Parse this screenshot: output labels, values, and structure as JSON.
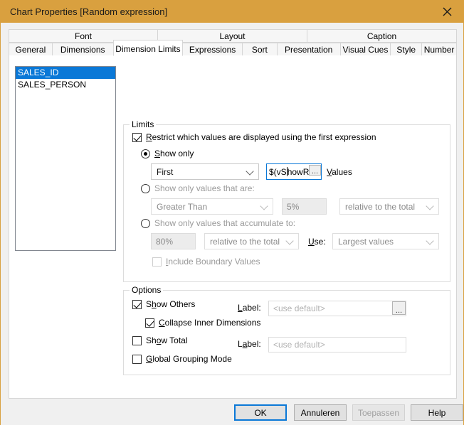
{
  "window": {
    "title": "Chart Properties [Random expression]",
    "close_icon": "close-icon",
    "titlebar_color": "#d9a03f",
    "accent_color": "#0a78d7"
  },
  "tabs": {
    "row1": [
      {
        "label": "Font",
        "active": false
      },
      {
        "label": "Layout",
        "active": false
      },
      {
        "label": "Caption",
        "active": false
      }
    ],
    "row2": [
      {
        "label": "General",
        "active": false
      },
      {
        "label": "Dimensions",
        "active": false
      },
      {
        "label": "Dimension Limits",
        "active": true
      },
      {
        "label": "Expressions",
        "active": false
      },
      {
        "label": "Sort",
        "active": false
      },
      {
        "label": "Presentation",
        "active": false
      },
      {
        "label": "Visual Cues",
        "active": false
      },
      {
        "label": "Style",
        "active": false
      },
      {
        "label": "Number",
        "active": false
      }
    ]
  },
  "dimension_list": {
    "items": [
      {
        "label": "SALES_ID",
        "selected": true
      },
      {
        "label": "SALES_PERSON",
        "selected": false
      }
    ]
  },
  "limits": {
    "group_title": "Limits",
    "restrict": {
      "label_pre": "R",
      "label_post": "estrict which values are displayed using the first expression",
      "checked": true
    },
    "show_only": {
      "label_pre": "S",
      "label_post": "how only",
      "selected": true,
      "rank_combo_value": "First",
      "value_input": "$(vS",
      "value_input_tail": "howR",
      "values_label_pre": "V",
      "values_label_post": "alues",
      "browse_label": "..."
    },
    "show_values_that_are": {
      "label": "Show only values that are:",
      "selected": false,
      "operator_combo_value": "Greater Than",
      "amount_value": "5%",
      "basis_combo_value": "relative to the total"
    },
    "show_accumulate": {
      "label": "Show only values that accumulate to:",
      "selected": false,
      "amount_value": "80%",
      "basis_combo_value": "relative to the total",
      "use_label_pre": "U",
      "use_label_post": "se:",
      "use_combo_value": "Largest values"
    },
    "include_boundary": {
      "label_pre": "I",
      "label_post": "nclude Boundary Values",
      "checked": false,
      "disabled": true
    }
  },
  "options": {
    "group_title": "Options",
    "show_others": {
      "label_pre_a": "S",
      "label_pre_b": "h",
      "label_post": "ow Others",
      "checked": true,
      "label_caption_pre": "L",
      "label_caption_post": "abel:",
      "label_value": "<use default>",
      "browse_label": "..."
    },
    "collapse_inner": {
      "label_pre": "C",
      "label_post": "ollapse Inner Dimensions",
      "checked": true
    },
    "show_total": {
      "label_pre_a": "Sh",
      "label_pre_b": "o",
      "label_post": "w Total",
      "checked": false,
      "label_caption_pre": "L",
      "label_caption_mid": "a",
      "label_caption_post": "bel:",
      "label_value": "<use default>"
    },
    "global_grouping": {
      "label_pre": "G",
      "label_post": "lobal Grouping Mode",
      "checked": false
    }
  },
  "footer": {
    "ok": "OK",
    "cancel": "Annuleren",
    "apply": "Toepassen",
    "help": "Help"
  }
}
